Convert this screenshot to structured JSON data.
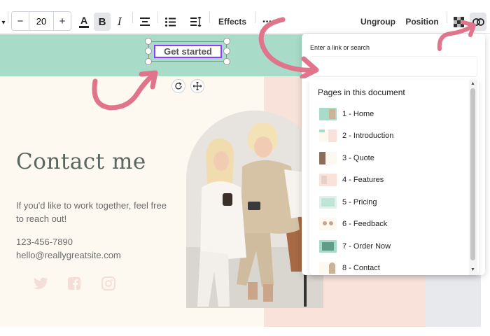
{
  "toolbar": {
    "font_size": "20",
    "decrease_label": "−",
    "increase_label": "+",
    "effects_label": "Effects",
    "more_label": "•••",
    "ungroup_label": "Ungroup",
    "position_label": "Position"
  },
  "canvas": {
    "button_text": "Get started",
    "contact_title": "Contact me",
    "lead_text": "If you'd like to work together, feel free to reach out!",
    "phone": "123-456-7890",
    "email": "hello@reallygreatsite.com",
    "social_icons": [
      "twitter-icon",
      "facebook-icon",
      "instagram-icon"
    ]
  },
  "link_popup": {
    "label": "Enter a link or search",
    "input_value": "",
    "pages_heading": "Pages in this document",
    "pages": [
      {
        "label": "1 - Home"
      },
      {
        "label": "2 - Introduction"
      },
      {
        "label": "3 - Quote"
      },
      {
        "label": "4 - Features"
      },
      {
        "label": "5 - Pricing"
      },
      {
        "label": "6 - Feedback"
      },
      {
        "label": "7 - Order Now"
      },
      {
        "label": "8 - Contact"
      }
    ]
  },
  "colors": {
    "accent": "#8b3dff",
    "mint": "#a8dcc9",
    "blush": "#f8e2da",
    "cream": "#fdf8f0",
    "annotation": "#e0748a",
    "text_dark": "#5a6660"
  }
}
